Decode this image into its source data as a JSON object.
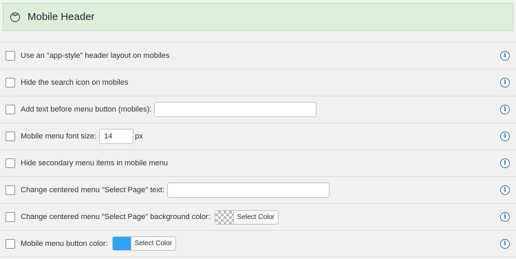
{
  "panel": {
    "title": "Mobile Header",
    "collapse_icon": "chevron-double-down"
  },
  "colors": {
    "header_bg": "#dcefd9",
    "info_icon": "#2271b1",
    "button_color_swatch": "#2ea3f2"
  },
  "rows": [
    {
      "label": "Use an \"app-style\" header layout on mobiles",
      "checked": false
    },
    {
      "label": "Hide the search icon on mobiles",
      "checked": false
    },
    {
      "label": "Add text before menu button (mobiles):",
      "checked": false,
      "input_value": ""
    },
    {
      "label": "Mobile menu font size:",
      "checked": false,
      "input_value": "14",
      "unit": "px"
    },
    {
      "label": "Hide secondary menu items in mobile menu",
      "checked": false
    },
    {
      "label": "Change centered menu \"Select Page\" text:",
      "checked": false,
      "input_value": ""
    },
    {
      "label": "Change centered menu \"Select Page\" background color:",
      "checked": false,
      "color_button_label": "Select Color"
    },
    {
      "label": "Mobile menu button color:",
      "checked": false,
      "color_button_label": "Select Color"
    }
  ],
  "info_icon_glyph": "i"
}
